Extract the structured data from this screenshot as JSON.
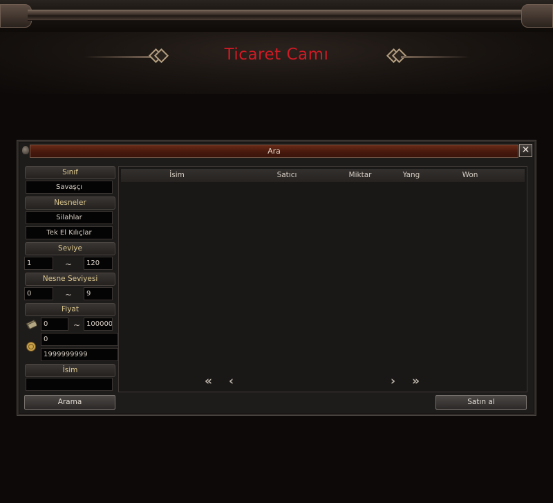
{
  "header": {
    "title": "Ticaret Camı"
  },
  "dialog": {
    "title": "Ara",
    "close_label": "✕"
  },
  "filters": {
    "class_label": "Sınıf",
    "class_value": "Savaşçı",
    "items_label": "Nesneler",
    "item_category": "Silahlar",
    "item_subcategory": "Tek El Kılıçlar",
    "level_label": "Seviye",
    "level_min": "1",
    "level_max": "120",
    "item_level_label": "Nesne Seviyesi",
    "item_level_min": "0",
    "item_level_max": "9",
    "price_label": "Fiyat",
    "yang_min": "0",
    "yang_max": "100000",
    "won_min": "0",
    "won_max": "1999999999",
    "name_label": "İsim",
    "name_value": "",
    "range_symbol": "~"
  },
  "results": {
    "columns": [
      "İsim",
      "Satıcı",
      "Miktar",
      "Yang",
      "Won"
    ],
    "rows": [],
    "nav": {
      "first": "«",
      "prev": "‹",
      "next": "›",
      "last": "»"
    }
  },
  "buttons": {
    "search": "Arama",
    "buy": "Satın al"
  },
  "colors": {
    "title": "#d01a24",
    "section_label": "#dcc88e",
    "titlebar": "#4a1a0e"
  },
  "icons": [
    "pin-icon",
    "close-icon",
    "yang-money-icon",
    "won-coin-icon",
    "first-page-icon",
    "prev-page-icon",
    "next-page-icon",
    "last-page-icon"
  ]
}
